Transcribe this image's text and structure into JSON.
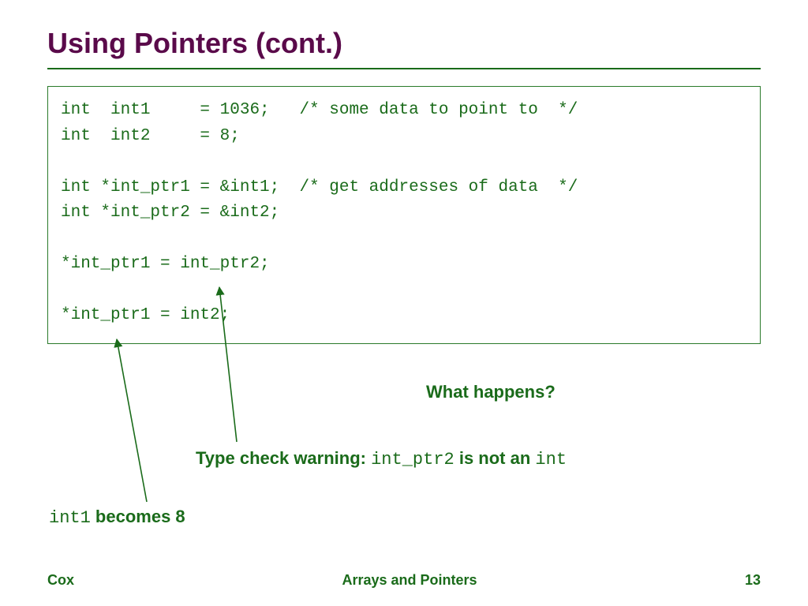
{
  "title": "Using Pointers (cont.)",
  "code": "int  int1     = 1036;   /* some data to point to  */\nint  int2     = 8;\n\nint *int_ptr1 = &int1;  /* get addresses of data  */\nint *int_ptr2 = &int2;\n\n*int_ptr1 = int_ptr2;\n\n*int_ptr1 = int2;",
  "q": "What happens?",
  "warn_prefix": "Type check warning:  ",
  "warn_mid": "int_ptr2",
  "warn_gap": " is not an ",
  "warn_end": "int",
  "becomes_prefix": "int1",
  "becomes_rest": " becomes 8",
  "footer_left": "Cox",
  "footer_center": "Arrays and Pointers",
  "footer_right": "13"
}
